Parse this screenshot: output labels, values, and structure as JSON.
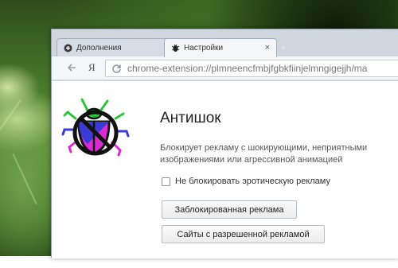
{
  "browser": {
    "tabs": [
      {
        "label": "Дополнения",
        "icon": "puzzle-icon",
        "active": false
      },
      {
        "label": "Настройки",
        "icon": "bug-icon",
        "active": true,
        "close": "×"
      }
    ],
    "new_tab": "+",
    "yandex_button": "Я",
    "address_bar": {
      "value": "chrome-extension://plmneencfmbjfgbkfiinjelmngigejjh/ma"
    }
  },
  "extension": {
    "name": "Антишок",
    "description": "Блокирует рекламу с шокирующими, неприятными изображениями или агрессивной анимацией",
    "option": {
      "label": "Не блокировать эротическую рекламу",
      "checked": false
    },
    "buttons": {
      "blocked": "Заблокированная реклама",
      "allowed": "Сайты с разрешенной рекламой"
    },
    "logo_icon": "antishock-bug-icon",
    "colors": {
      "logo_blue": "#3a3ad6",
      "logo_magenta": "#d92bd0",
      "logo_green": "#2cc43a"
    }
  }
}
